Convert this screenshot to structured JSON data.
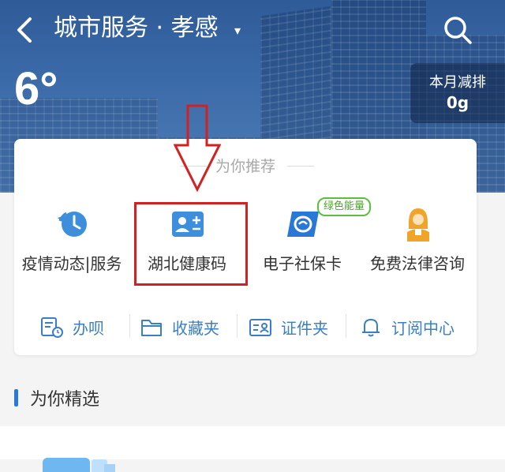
{
  "header": {
    "title": "城市服务 · 孝感",
    "caret": "▾",
    "temperature": "6°",
    "emission_label": "本月减排",
    "emission_value": "0g"
  },
  "recommend": {
    "title": "为你推荐",
    "services": [
      {
        "label": "疫情动态|服务",
        "icon": "clock-history-icon"
      },
      {
        "label": "湖北健康码",
        "icon": "health-card-icon"
      },
      {
        "label": "电子社保卡",
        "icon": "social-security-card-icon"
      },
      {
        "label": "免费法律咨询",
        "icon": "judge-icon"
      }
    ],
    "badge": "绿色能量"
  },
  "actions": [
    {
      "label": "办呗",
      "icon": "document-clock-icon"
    },
    {
      "label": "收藏夹",
      "icon": "folder-icon"
    },
    {
      "label": "证件夹",
      "icon": "id-card-icon"
    },
    {
      "label": "订阅中心",
      "icon": "bell-icon"
    }
  ],
  "section": {
    "title": "为你精选"
  },
  "colors": {
    "accent": "#2a78d6",
    "highlight": "#d32020",
    "green_badge": "#5cbf3a"
  }
}
